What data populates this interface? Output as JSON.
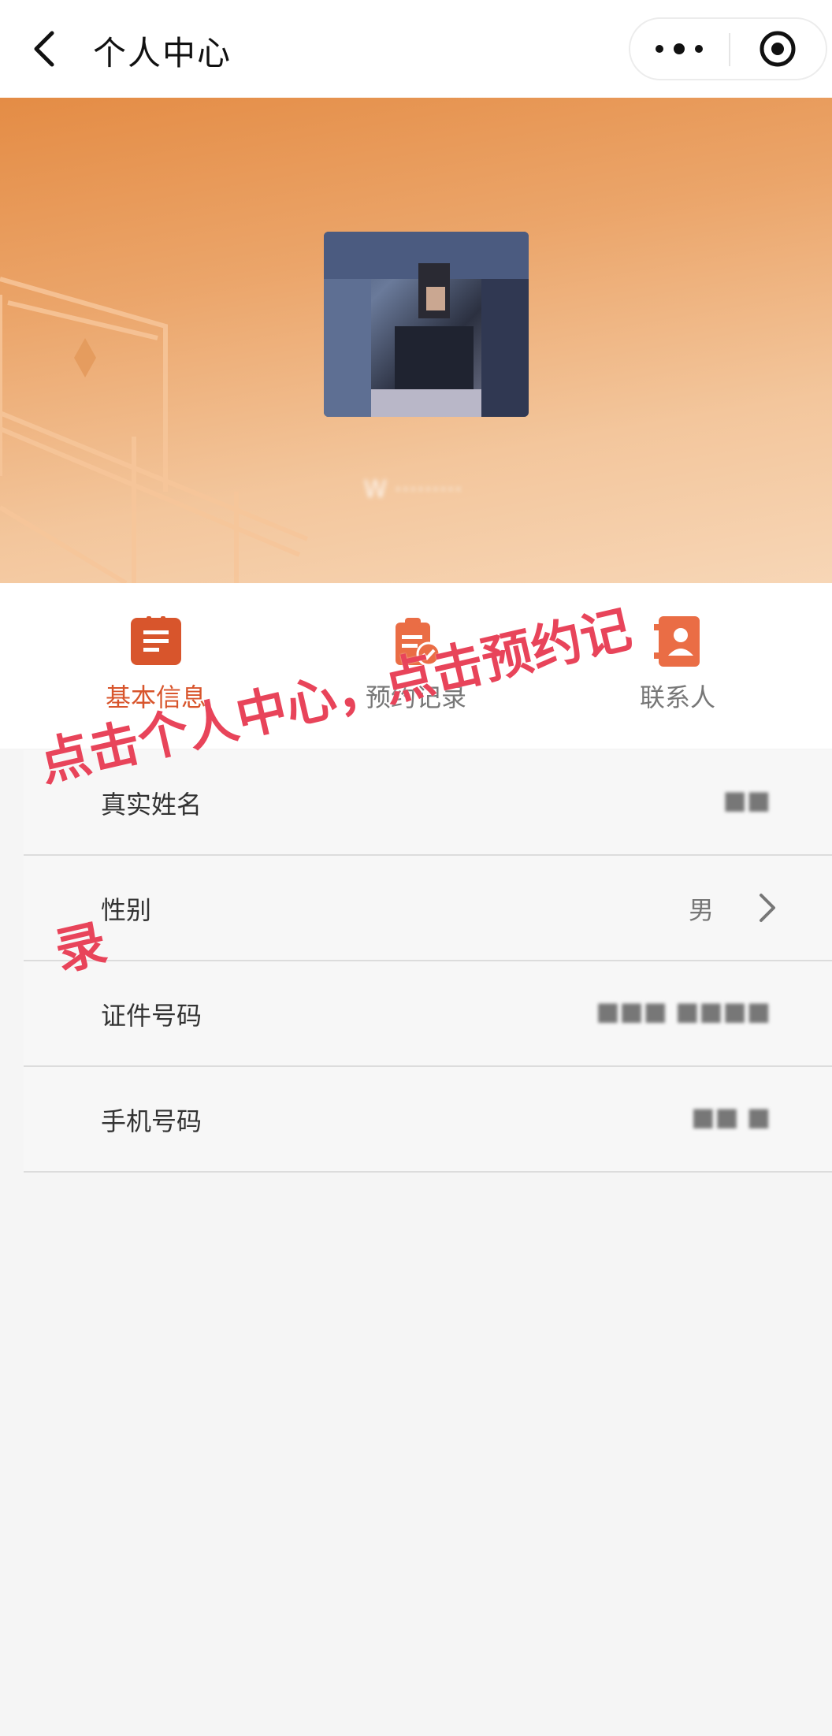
{
  "navbar": {
    "title": "个人中心",
    "back_icon": "chevron-left-icon",
    "more_icon": "more-dots-icon",
    "target_icon": "target-icon"
  },
  "profile": {
    "nickname": "W ·········"
  },
  "tabs": [
    {
      "label": "基本信息",
      "icon": "id-card-icon",
      "active": true
    },
    {
      "label": "预约记录",
      "icon": "clipboard-check-icon",
      "active": false
    },
    {
      "label": "联系人",
      "icon": "contact-book-icon",
      "active": false
    }
  ],
  "form": {
    "rows": [
      {
        "label": "真实姓名",
        "value": "■■"
      },
      {
        "label": "性别",
        "value": "男"
      },
      {
        "label": "证件号码",
        "value": "■■■ ■■■■"
      },
      {
        "label": "手机号码",
        "value": "■■ ■"
      }
    ]
  },
  "annotation": {
    "line1": "点击个人中心，点击预约记",
    "line2": "录"
  },
  "colors": {
    "accent": "#d8552c",
    "banner_start": "#e48c45",
    "banner_end": "#f7d6b6",
    "annotation": "#e8445a"
  }
}
